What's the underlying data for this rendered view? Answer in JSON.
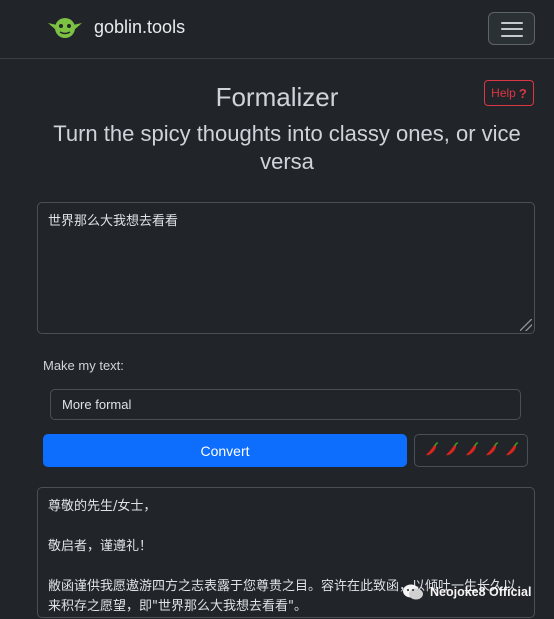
{
  "navbar": {
    "brand": "goblin.tools"
  },
  "tool": {
    "title": "Formalizer",
    "help_label": "Help",
    "help_mark": "?",
    "subtitle": "Turn the spicy thoughts into classy ones, or vice versa"
  },
  "input": {
    "value": "世界那么大我想去看看"
  },
  "form": {
    "label": "Make my text:",
    "selected_option": "More formal",
    "convert_label": "Convert",
    "spiciness_level": 5,
    "spiciness_max": 5
  },
  "output": {
    "line1": "尊敬的先生/女士，",
    "line2": "敬启者，谨遵礼！",
    "line3": "敝函谨供我愿遨游四方之志表露于您尊贵之目。容许在此致函，以倾吐一生长久以来积存之愿望，即\"世界那么大我想去看看\"。"
  },
  "watermark": {
    "text": "Neojoke8 Official"
  },
  "colors": {
    "background": "#212529",
    "primary": "#0d6efd",
    "danger": "#dc3545",
    "logo_green": "#7dc142"
  }
}
